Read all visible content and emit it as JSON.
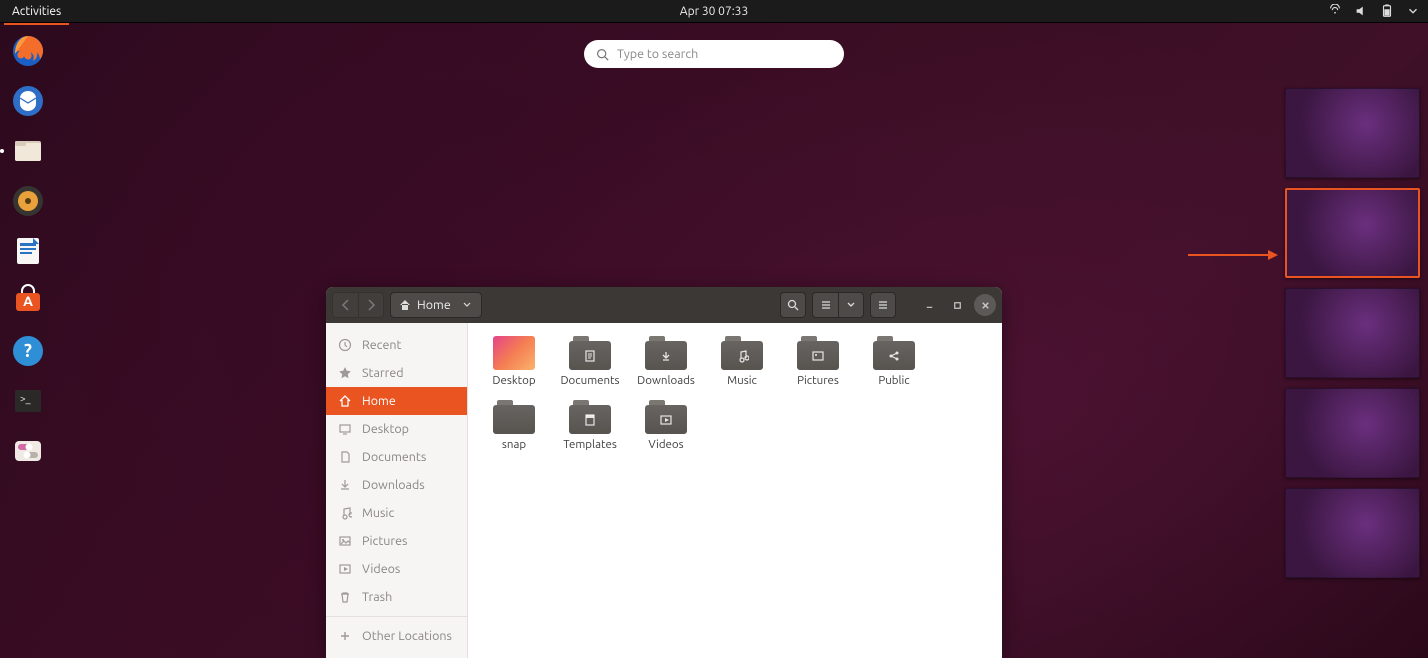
{
  "panel": {
    "activities": "Activities",
    "clock": "Apr 30  07:33"
  },
  "search": {
    "placeholder": "Type to search"
  },
  "dock": {
    "items": [
      {
        "name": "firefox",
        "type": "app"
      },
      {
        "name": "thunderbird",
        "type": "app"
      },
      {
        "name": "files",
        "type": "app",
        "running": true
      },
      {
        "name": "rhythmbox",
        "type": "app"
      },
      {
        "name": "libreoffice-writer",
        "type": "app"
      },
      {
        "name": "software",
        "type": "app"
      },
      {
        "name": "help",
        "type": "app"
      },
      {
        "name": "terminal",
        "type": "app"
      },
      {
        "name": "settings",
        "type": "app"
      }
    ]
  },
  "workspaces": {
    "count": 5,
    "active_index": 1
  },
  "nautilus": {
    "path_label": "Home",
    "sidebar": [
      {
        "label": "Recent",
        "icon": "clock"
      },
      {
        "label": "Starred",
        "icon": "star"
      },
      {
        "label": "Home",
        "icon": "home",
        "active": true
      },
      {
        "label": "Desktop",
        "icon": "desktop"
      },
      {
        "label": "Documents",
        "icon": "documents"
      },
      {
        "label": "Downloads",
        "icon": "downloads"
      },
      {
        "label": "Music",
        "icon": "music"
      },
      {
        "label": "Pictures",
        "icon": "pictures"
      },
      {
        "label": "Videos",
        "icon": "videos"
      },
      {
        "label": "Trash",
        "icon": "trash"
      }
    ],
    "sidebar_other": "Other Locations",
    "folders": [
      {
        "label": "Desktop",
        "style": "desktop"
      },
      {
        "label": "Documents",
        "style": "grey",
        "glyph": "doc"
      },
      {
        "label": "Downloads",
        "style": "grey",
        "glyph": "down"
      },
      {
        "label": "Music",
        "style": "grey",
        "glyph": "music"
      },
      {
        "label": "Pictures",
        "style": "grey",
        "glyph": "pic"
      },
      {
        "label": "Public",
        "style": "grey",
        "glyph": "share"
      },
      {
        "label": "snap",
        "style": "grey-plain"
      },
      {
        "label": "Templates",
        "style": "grey",
        "glyph": "tmpl"
      },
      {
        "label": "Videos",
        "style": "grey",
        "glyph": "vid"
      }
    ]
  }
}
